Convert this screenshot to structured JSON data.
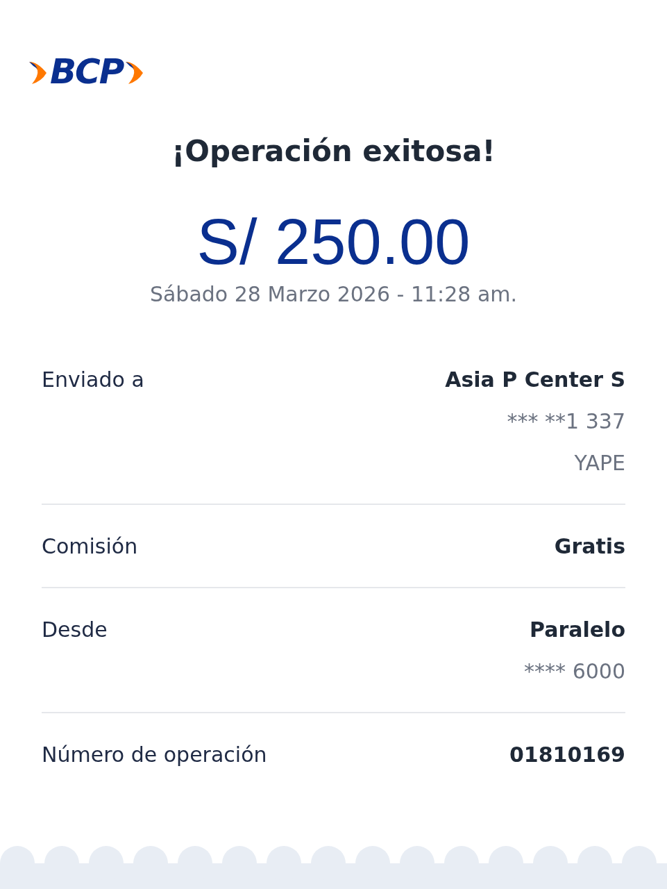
{
  "logo": {
    "text": "BCP"
  },
  "title": "¡Operación exitosa!",
  "amount": "S/ 250.00",
  "date": "Sábado 28 Marzo 2026 - 11:28 am.",
  "details": [
    {
      "label": "Enviado a",
      "values": [
        {
          "text": "Asia P Center S",
          "kind": "primary"
        },
        {
          "text": "*** **1 337",
          "kind": "secondary"
        },
        {
          "text": "YAPE",
          "kind": "secondary"
        }
      ]
    },
    {
      "label": "Comisión",
      "values": [
        {
          "text": "Gratis",
          "kind": "primary"
        }
      ]
    },
    {
      "label": "Desde",
      "values": [
        {
          "text": "Paralelo",
          "kind": "primary"
        },
        {
          "text": "**** 6000",
          "kind": "secondary"
        }
      ]
    },
    {
      "label": "Número de operación",
      "values": [
        {
          "text": "01810169",
          "kind": "primary"
        }
      ]
    }
  ]
}
